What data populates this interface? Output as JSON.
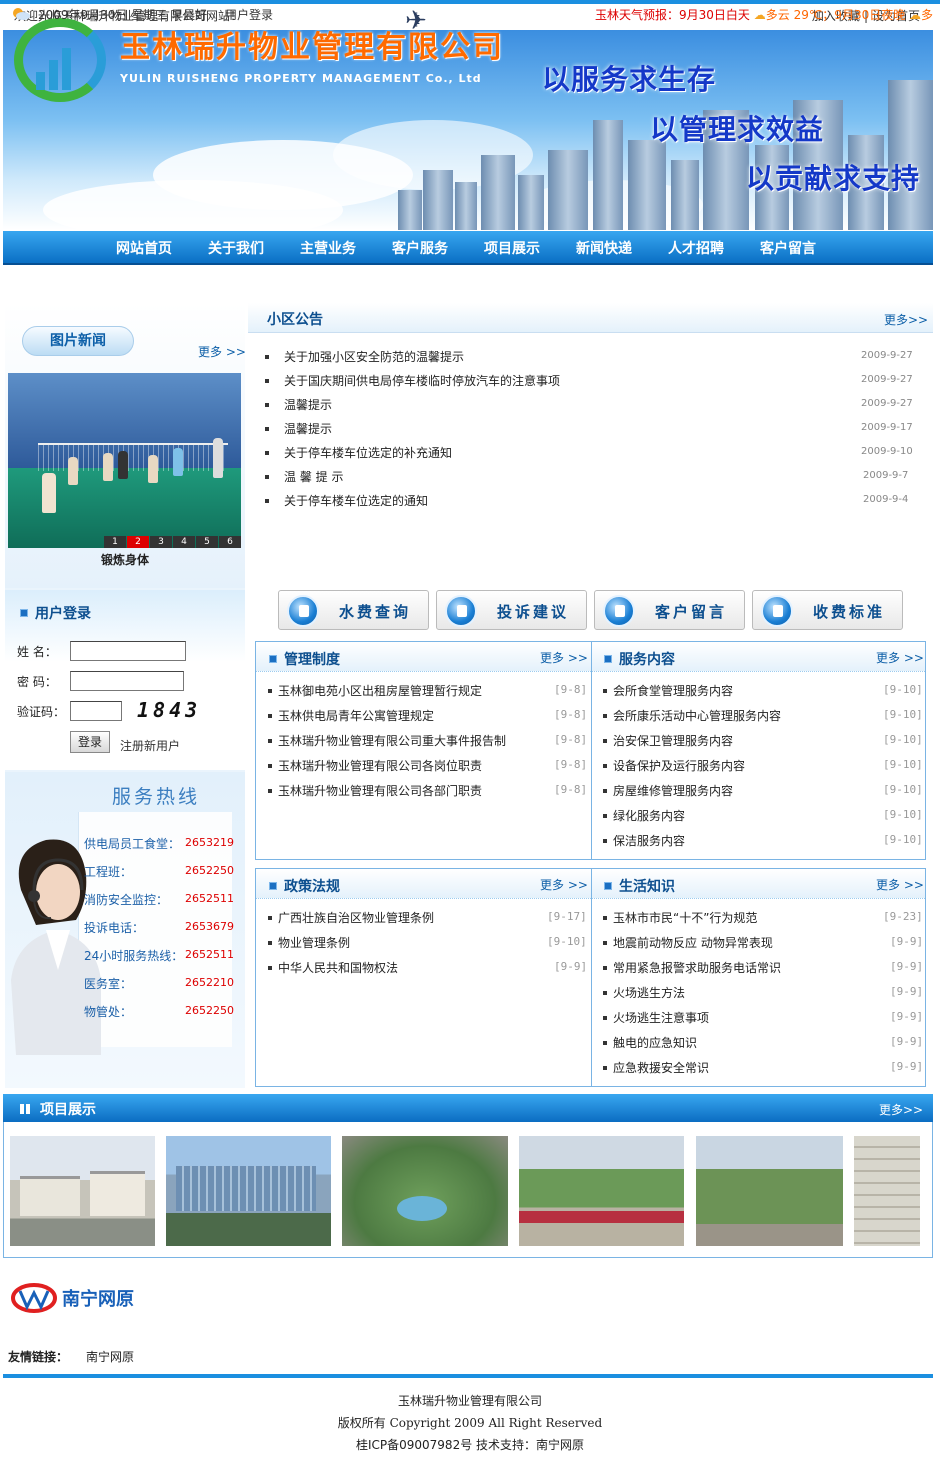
{
  "topbar": {
    "welcome": "欢迎光临玉林瑞升物业管理有限公司网站！",
    "bookmark": "加入收藏",
    "sep": "|",
    "homepage": "设为首页"
  },
  "banner": {
    "company_cn": "玉林瑞升物业管理有限公司",
    "company_en": "YULIN RUISHENG PROPERTY MANAGEMENT Co., Ltd",
    "slogans": [
      "以服务求生存",
      "以管理求效益",
      "以贡献求支持"
    ]
  },
  "nav": [
    "网站首页",
    "关于我们",
    "主营业务",
    "客户服务",
    "项目展示",
    "新闻快递",
    "人才招聘",
    "客户留言"
  ],
  "datebar": {
    "date": "2009年9月30日  星期三  早晨好",
    "login": "用户登录",
    "weather_label": "玉林天气预报：",
    "weather_text1": "9月30日白天",
    "weather_text2": "多云 29℃；9月30日夜晚",
    "weather_text3": "多"
  },
  "photo_news": {
    "title": "图片新闻",
    "more": "更多 >>",
    "caption": "锻炼身体",
    "pages": [
      "1",
      "2",
      "3",
      "4",
      "5",
      "6"
    ],
    "active_page": "2"
  },
  "login": {
    "title": "用户登录",
    "name_label": "姓    名：",
    "pwd_label": "密    码：",
    "code_label": "验证码：",
    "captcha": "1843",
    "button": "登录",
    "register": "注册新用户"
  },
  "hotline": {
    "title": "服务热线",
    "items": [
      {
        "name": "供电局员工食堂：",
        "phone": "2653219"
      },
      {
        "name": "工程班：",
        "phone": "2652250"
      },
      {
        "name": "消防安全监控：",
        "phone": "2652511"
      },
      {
        "name": "投诉电话：",
        "phone": "2653679"
      },
      {
        "name": "24小时服务热线：",
        "phone": "2652511"
      },
      {
        "name": "医务室：",
        "phone": "2652210"
      },
      {
        "name": "物管处：",
        "phone": "2652250"
      }
    ]
  },
  "notice": {
    "title": "小区公告",
    "more": "更多>>",
    "items": [
      {
        "text": "关于加强小区安全防范的温馨提示",
        "date": "2009-9-27"
      },
      {
        "text": "关于国庆期间供电局停车楼临时停放汽车的注意事项",
        "date": "2009-9-27"
      },
      {
        "text": "温馨提示",
        "date": "2009-9-27"
      },
      {
        "text": "温馨提示",
        "date": "2009-9-17"
      },
      {
        "text": "关于停车楼车位选定的补充通知",
        "date": "2009-9-10"
      },
      {
        "text": "温  馨  提  示",
        "date": "2009-9-7"
      },
      {
        "text": "关于停车楼车位选定的通知",
        "date": "2009-9-4"
      }
    ]
  },
  "services": [
    "水费查询",
    "投诉建议",
    "客户留言",
    "收费标准"
  ],
  "boxes": {
    "rules": {
      "title": "管理制度",
      "more": "更多 >>",
      "items": [
        {
          "text": "玉林御电苑小区出租房屋管理暂行规定",
          "date": "[9-8]"
        },
        {
          "text": "玉林供电局青年公寓管理规定",
          "date": "[9-8]"
        },
        {
          "text": "玉林瑞升物业管理有限公司重大事件报告制",
          "date": "[9-8]"
        },
        {
          "text": "玉林瑞升物业管理有限公司各岗位职责",
          "date": "[9-8]"
        },
        {
          "text": "玉林瑞升物业管理有限公司各部门职责",
          "date": "[9-8]"
        }
      ]
    },
    "content": {
      "title": "服务内容",
      "more": "更多 >>",
      "items": [
        {
          "text": "会所食堂管理服务内容",
          "date": "[9-10]"
        },
        {
          "text": "会所康乐活动中心管理服务内容",
          "date": "[9-10]"
        },
        {
          "text": "治安保卫管理服务内容",
          "date": "[9-10]"
        },
        {
          "text": "设备保护及运行服务内容",
          "date": "[9-10]"
        },
        {
          "text": "房屋维修管理服务内容",
          "date": "[9-10]"
        },
        {
          "text": "绿化服务内容",
          "date": "[9-10]"
        },
        {
          "text": "保洁服务内容",
          "date": "[9-10]"
        }
      ]
    },
    "laws": {
      "title": "政策法规",
      "more": "更多 >>",
      "items": [
        {
          "text": "广西壮族自治区物业管理条例",
          "date": "[9-17]"
        },
        {
          "text": "物业管理条例",
          "date": "[9-10]"
        },
        {
          "text": "中华人民共和国物权法",
          "date": "[9-9]"
        }
      ]
    },
    "life": {
      "title": "生活知识",
      "more": "更多 >>",
      "items": [
        {
          "text": "玉林市市民“十不”行为规范",
          "date": "[9-23]"
        },
        {
          "text": "地震前动物反应   动物异常表现",
          "date": "[9-9]"
        },
        {
          "text": "常用紧急报警求助服务电话常识",
          "date": "[9-9]"
        },
        {
          "text": "火场逃生方法",
          "date": "[9-9]"
        },
        {
          "text": "火场逃生注意事项",
          "date": "[9-9]"
        },
        {
          "text": "触电的应急知识",
          "date": "[9-9]"
        },
        {
          "text": "应急救援安全常识",
          "date": "[9-9]"
        }
      ]
    }
  },
  "projects": {
    "title": "项目展示",
    "more": "更多>>"
  },
  "partner_logo": "南宁网原",
  "links": {
    "label": "友情链接：",
    "items": "南宁网原"
  },
  "footer": {
    "line1": "玉林瑞升物业管理有限公司",
    "line2": "版权所有 Copyright 2009 All Right Reserved",
    "line3": "桂ICP备09007982号   技术支持：南宁网原"
  },
  "colors": {
    "accent": "#1b8fe0",
    "nav": "#0a6fc4",
    "title_blue": "#0d4f8f",
    "phone_red": "#dd0000",
    "logo_orange": "#ff6a00"
  }
}
